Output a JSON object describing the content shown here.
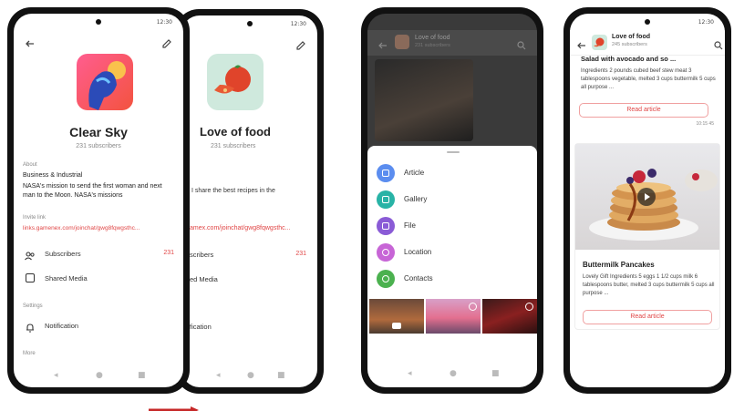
{
  "status": {
    "time": "12:30"
  },
  "profile": {
    "name": "Clear Sky",
    "subscribers": "231 subscribers",
    "about_label": "About",
    "category": "Business & Industrial",
    "description": "NASA's mission to send the first woman and next man to the Moon. NASA's missions",
    "invite_label": "Invite link",
    "invite_link": "links.gamenex.com/joinchat/gwg8fqwgsthc...",
    "subscribers_label": "Subscribers",
    "subscribers_count": "231",
    "media_label": "Shared Media",
    "settings_label": "Settings",
    "notification_label": "Notification",
    "more_label": "More"
  },
  "profile2": {
    "name": "Love of food",
    "subscribers": "231 subscribers",
    "desc_fragment": "I share the best recipes in the",
    "link_fragment": "amex.com/joinchat/gwg8fqwgsthc...",
    "subscribers_fragment": "scribers",
    "subscribers_count": "231",
    "media_fragment": "ed Media",
    "notification_fragment": "fication"
  },
  "attach": {
    "channel_name": "Love of food",
    "subscribers": "231 subscribers",
    "items": [
      {
        "label": "Article",
        "color": "#5b8def"
      },
      {
        "label": "Gallery",
        "color": "#28b3a6"
      },
      {
        "label": "File",
        "color": "#8a5bd6"
      },
      {
        "label": "Location",
        "color": "#c765d6"
      },
      {
        "label": "Contacts",
        "color": "#4bb14f"
      }
    ]
  },
  "feed": {
    "channel_name": "Love of food",
    "subscribers": "245 subscribers",
    "post1_title": "Salad with avocado and so ...",
    "post1_text": "Ingredients 2 pounds cubed beef stew meat 3 tablespoons vegetable, melted 3 cups buttermilk 5 cups all purpose ...",
    "read_article": "Read article",
    "post1_meta": "10:15  45",
    "post2_title": "Buttermilk Pancakes",
    "post2_text": "Lovely Gift Ingredients 5 eggs 1 1/2 cups milk 6 tablespoons butter, melted 3 cups buttermilk 5 cups all purpose ...",
    "read_article2": "Read article"
  },
  "colors": {
    "accent": "#e04646",
    "arrow": "#c62828"
  },
  "icons": {
    "back": "back-arrow-icon",
    "edit": "pencil-edit-icon",
    "users": "users-icon",
    "media": "image-icon",
    "bell": "bell-icon",
    "search": "search-icon",
    "play": "play-icon"
  }
}
